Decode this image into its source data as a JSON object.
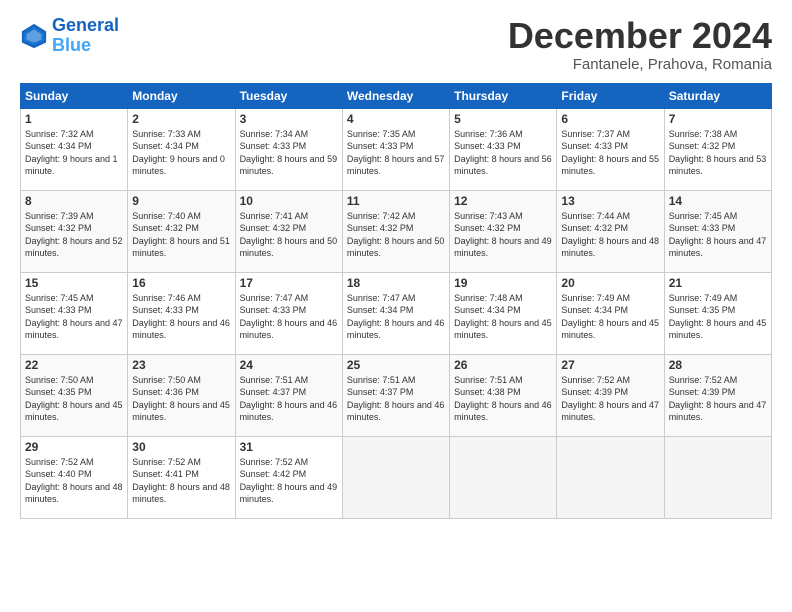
{
  "header": {
    "logo_line1": "General",
    "logo_line2": "Blue",
    "month": "December 2024",
    "location": "Fantanele, Prahova, Romania"
  },
  "days_of_week": [
    "Sunday",
    "Monday",
    "Tuesday",
    "Wednesday",
    "Thursday",
    "Friday",
    "Saturday"
  ],
  "weeks": [
    [
      {
        "day": 1,
        "sunrise": "7:32 AM",
        "sunset": "4:34 PM",
        "daylight": "9 hours and 1 minute."
      },
      {
        "day": 2,
        "sunrise": "7:33 AM",
        "sunset": "4:34 PM",
        "daylight": "9 hours and 0 minutes."
      },
      {
        "day": 3,
        "sunrise": "7:34 AM",
        "sunset": "4:33 PM",
        "daylight": "8 hours and 59 minutes."
      },
      {
        "day": 4,
        "sunrise": "7:35 AM",
        "sunset": "4:33 PM",
        "daylight": "8 hours and 57 minutes."
      },
      {
        "day": 5,
        "sunrise": "7:36 AM",
        "sunset": "4:33 PM",
        "daylight": "8 hours and 56 minutes."
      },
      {
        "day": 6,
        "sunrise": "7:37 AM",
        "sunset": "4:33 PM",
        "daylight": "8 hours and 55 minutes."
      },
      {
        "day": 7,
        "sunrise": "7:38 AM",
        "sunset": "4:32 PM",
        "daylight": "8 hours and 53 minutes."
      }
    ],
    [
      {
        "day": 8,
        "sunrise": "7:39 AM",
        "sunset": "4:32 PM",
        "daylight": "8 hours and 52 minutes."
      },
      {
        "day": 9,
        "sunrise": "7:40 AM",
        "sunset": "4:32 PM",
        "daylight": "8 hours and 51 minutes."
      },
      {
        "day": 10,
        "sunrise": "7:41 AM",
        "sunset": "4:32 PM",
        "daylight": "8 hours and 50 minutes."
      },
      {
        "day": 11,
        "sunrise": "7:42 AM",
        "sunset": "4:32 PM",
        "daylight": "8 hours and 50 minutes."
      },
      {
        "day": 12,
        "sunrise": "7:43 AM",
        "sunset": "4:32 PM",
        "daylight": "8 hours and 49 minutes."
      },
      {
        "day": 13,
        "sunrise": "7:44 AM",
        "sunset": "4:32 PM",
        "daylight": "8 hours and 48 minutes."
      },
      {
        "day": 14,
        "sunrise": "7:45 AM",
        "sunset": "4:33 PM",
        "daylight": "8 hours and 47 minutes."
      }
    ],
    [
      {
        "day": 15,
        "sunrise": "7:45 AM",
        "sunset": "4:33 PM",
        "daylight": "8 hours and 47 minutes."
      },
      {
        "day": 16,
        "sunrise": "7:46 AM",
        "sunset": "4:33 PM",
        "daylight": "8 hours and 46 minutes."
      },
      {
        "day": 17,
        "sunrise": "7:47 AM",
        "sunset": "4:33 PM",
        "daylight": "8 hours and 46 minutes."
      },
      {
        "day": 18,
        "sunrise": "7:47 AM",
        "sunset": "4:34 PM",
        "daylight": "8 hours and 46 minutes."
      },
      {
        "day": 19,
        "sunrise": "7:48 AM",
        "sunset": "4:34 PM",
        "daylight": "8 hours and 45 minutes."
      },
      {
        "day": 20,
        "sunrise": "7:49 AM",
        "sunset": "4:34 PM",
        "daylight": "8 hours and 45 minutes."
      },
      {
        "day": 21,
        "sunrise": "7:49 AM",
        "sunset": "4:35 PM",
        "daylight": "8 hours and 45 minutes."
      }
    ],
    [
      {
        "day": 22,
        "sunrise": "7:50 AM",
        "sunset": "4:35 PM",
        "daylight": "8 hours and 45 minutes."
      },
      {
        "day": 23,
        "sunrise": "7:50 AM",
        "sunset": "4:36 PM",
        "daylight": "8 hours and 45 minutes."
      },
      {
        "day": 24,
        "sunrise": "7:51 AM",
        "sunset": "4:37 PM",
        "daylight": "8 hours and 46 minutes."
      },
      {
        "day": 25,
        "sunrise": "7:51 AM",
        "sunset": "4:37 PM",
        "daylight": "8 hours and 46 minutes."
      },
      {
        "day": 26,
        "sunrise": "7:51 AM",
        "sunset": "4:38 PM",
        "daylight": "8 hours and 46 minutes."
      },
      {
        "day": 27,
        "sunrise": "7:52 AM",
        "sunset": "4:39 PM",
        "daylight": "8 hours and 47 minutes."
      },
      {
        "day": 28,
        "sunrise": "7:52 AM",
        "sunset": "4:39 PM",
        "daylight": "8 hours and 47 minutes."
      }
    ],
    [
      {
        "day": 29,
        "sunrise": "7:52 AM",
        "sunset": "4:40 PM",
        "daylight": "8 hours and 48 minutes."
      },
      {
        "day": 30,
        "sunrise": "7:52 AM",
        "sunset": "4:41 PM",
        "daylight": "8 hours and 48 minutes."
      },
      {
        "day": 31,
        "sunrise": "7:52 AM",
        "sunset": "4:42 PM",
        "daylight": "8 hours and 49 minutes."
      },
      null,
      null,
      null,
      null
    ]
  ]
}
